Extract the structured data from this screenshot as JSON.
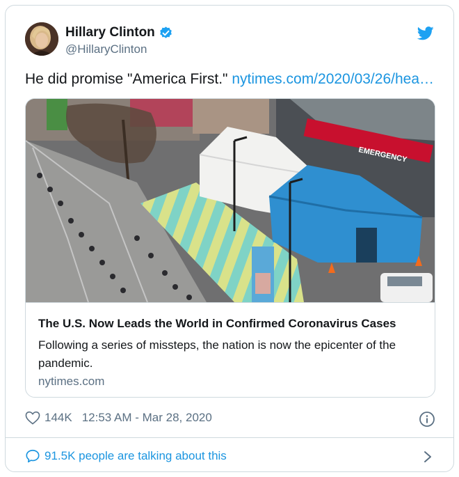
{
  "author": {
    "name": "Hillary Clinton",
    "handle": "@HillaryClinton",
    "verified": true
  },
  "tweet": {
    "text": "He did promise \"America First.\"",
    "link": "nytimes.com/2020/03/26/hea…"
  },
  "link_card": {
    "title": "The U.S. Now Leads the World in Confirmed Coronavirus Cases",
    "description": "Following a series of missteps, the nation is now the epicenter of the pandemic.",
    "domain": "nytimes.com",
    "image_signs": {
      "emergency": "EMERGENCY"
    }
  },
  "meta": {
    "likes": "144K",
    "timestamp": "12:53 AM - Mar 28, 2020"
  },
  "footer": {
    "talking": "91.5K people are talking about this"
  },
  "colors": {
    "accent": "#1b95e0",
    "verified": "#1da1f2",
    "muted": "#5b7083",
    "border": "#cfd9de",
    "tent_blue": "#2f8fd0",
    "emergency_red": "#c8102e"
  },
  "icons": [
    "avatar",
    "verified-badge-icon",
    "twitter-bird-icon",
    "heart-icon",
    "info-icon",
    "speech-bubble-icon",
    "chevron-right-icon"
  ]
}
